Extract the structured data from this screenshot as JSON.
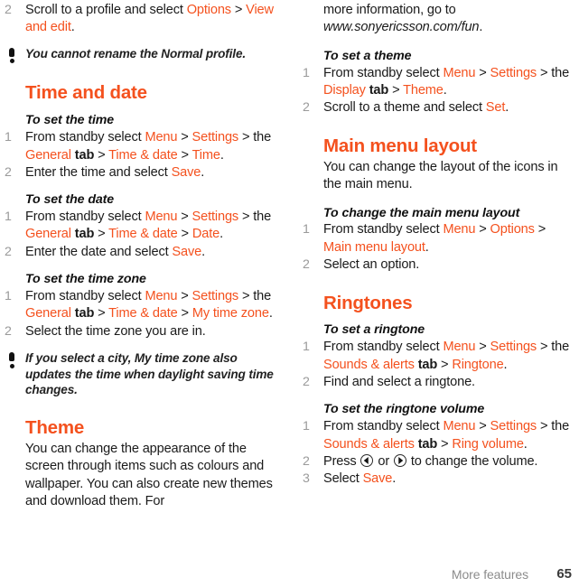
{
  "document": {
    "footer": {
      "chapter_title": "More features",
      "page_number": "65"
    }
  },
  "left_column": {
    "carryover_step": {
      "number": "2",
      "text_before": "Scroll to a profile and select ",
      "ui_1": "Options",
      "sep_1": " > ",
      "ui_2": "View and edit",
      "text_after": "."
    },
    "note_profile": {
      "icon": "exclamation-note-icon",
      "part_1": "You cannot rename the ",
      "part_2_italic_regular": "Normal",
      "part_3": " profile."
    },
    "section_time_and_date": {
      "heading": "Time and date",
      "procedures": [
        {
          "title": "To set the time",
          "steps": [
            {
              "number": "1",
              "segments": [
                {
                  "t": "From standby select ",
                  "style": "plain"
                },
                {
                  "t": "Menu",
                  "style": "ui"
                },
                {
                  "t": " > ",
                  "style": "plain"
                },
                {
                  "t": "Settings",
                  "style": "ui"
                },
                {
                  "t": " > the ",
                  "style": "plain"
                },
                {
                  "t": "General",
                  "style": "ui"
                },
                {
                  "t": " tab > ",
                  "style": "bold-tab"
                },
                {
                  "t": "Time & date",
                  "style": "ui"
                },
                {
                  "t": " > ",
                  "style": "plain"
                },
                {
                  "t": "Time",
                  "style": "ui"
                },
                {
                  "t": ".",
                  "style": "plain"
                }
              ]
            },
            {
              "number": "2",
              "segments": [
                {
                  "t": "Enter the time and select ",
                  "style": "plain"
                },
                {
                  "t": "Save",
                  "style": "ui"
                },
                {
                  "t": ".",
                  "style": "plain"
                }
              ]
            }
          ]
        },
        {
          "title": "To set the date",
          "steps": [
            {
              "number": "1",
              "segments": [
                {
                  "t": "From standby select ",
                  "style": "plain"
                },
                {
                  "t": "Menu",
                  "style": "ui"
                },
                {
                  "t": " > ",
                  "style": "plain"
                },
                {
                  "t": "Settings",
                  "style": "ui"
                },
                {
                  "t": " > the ",
                  "style": "plain"
                },
                {
                  "t": "General",
                  "style": "ui"
                },
                {
                  "t": " tab > ",
                  "style": "bold-tab"
                },
                {
                  "t": "Time & date",
                  "style": "ui"
                },
                {
                  "t": " > ",
                  "style": "plain"
                },
                {
                  "t": "Date",
                  "style": "ui"
                },
                {
                  "t": ".",
                  "style": "plain"
                }
              ]
            },
            {
              "number": "2",
              "segments": [
                {
                  "t": "Enter the date and select ",
                  "style": "plain"
                },
                {
                  "t": "Save",
                  "style": "ui"
                },
                {
                  "t": ".",
                  "style": "plain"
                }
              ]
            }
          ]
        },
        {
          "title": "To set the time zone",
          "steps": [
            {
              "number": "1",
              "segments": [
                {
                  "t": "From standby select ",
                  "style": "plain"
                },
                {
                  "t": "Menu",
                  "style": "ui"
                },
                {
                  "t": " > ",
                  "style": "plain"
                },
                {
                  "t": "Settings",
                  "style": "ui"
                },
                {
                  "t": " > the ",
                  "style": "plain"
                },
                {
                  "t": "General",
                  "style": "ui"
                },
                {
                  "t": " tab > ",
                  "style": "bold-tab"
                },
                {
                  "t": "Time & date",
                  "style": "ui"
                },
                {
                  "t": " > ",
                  "style": "plain"
                },
                {
                  "t": "My time zone",
                  "style": "ui"
                },
                {
                  "t": ".",
                  "style": "plain"
                }
              ]
            },
            {
              "number": "2",
              "segments": [
                {
                  "t": "Select the time zone you are in.",
                  "style": "plain"
                }
              ]
            }
          ]
        }
      ]
    },
    "note_timezone": {
      "icon": "exclamation-note-icon",
      "part_1": "If you select a city, ",
      "part_2_italic_regular": "My time zone",
      "part_3": " also updates the time when daylight saving time changes."
    },
    "section_theme": {
      "heading": "Theme",
      "body_start": "You can change the appearance of the screen through items such as colours and wallpaper. You can also create new themes and download them. For"
    }
  },
  "right_column": {
    "theme_continued": {
      "text_before": "more information, go to ",
      "url": "www.sonyericsson.com/fun",
      "text_after": "."
    },
    "procedure_set_theme": {
      "title": "To set a theme",
      "steps": [
        {
          "number": "1",
          "segments": [
            {
              "t": "From standby select ",
              "style": "plain"
            },
            {
              "t": "Menu",
              "style": "ui"
            },
            {
              "t": " > ",
              "style": "plain"
            },
            {
              "t": "Settings",
              "style": "ui"
            },
            {
              "t": " > the ",
              "style": "plain"
            },
            {
              "t": "Display",
              "style": "ui"
            },
            {
              "t": " tab > ",
              "style": "bold-tab"
            },
            {
              "t": "Theme",
              "style": "ui"
            },
            {
              "t": ".",
              "style": "plain"
            }
          ]
        },
        {
          "number": "2",
          "segments": [
            {
              "t": "Scroll to a theme and select ",
              "style": "plain"
            },
            {
              "t": "Set",
              "style": "ui"
            },
            {
              "t": ".",
              "style": "plain"
            }
          ]
        }
      ]
    },
    "section_main_menu_layout": {
      "heading": "Main menu layout",
      "body": "You can change the layout of the icons in the main menu.",
      "procedures": [
        {
          "title": "To change the main menu layout",
          "steps": [
            {
              "number": "1",
              "segments": [
                {
                  "t": "From standby select ",
                  "style": "plain"
                },
                {
                  "t": "Menu",
                  "style": "ui"
                },
                {
                  "t": " > ",
                  "style": "plain"
                },
                {
                  "t": "Options",
                  "style": "ui"
                },
                {
                  "t": " > ",
                  "style": "plain"
                },
                {
                  "t": "Main menu layout",
                  "style": "ui"
                },
                {
                  "t": ".",
                  "style": "plain"
                }
              ]
            },
            {
              "number": "2",
              "segments": [
                {
                  "t": "Select an option.",
                  "style": "plain"
                }
              ]
            }
          ]
        }
      ]
    },
    "section_ringtones": {
      "heading": "Ringtones",
      "procedures": [
        {
          "title": "To set a ringtone",
          "steps": [
            {
              "number": "1",
              "segments": [
                {
                  "t": "From standby select ",
                  "style": "plain"
                },
                {
                  "t": "Menu",
                  "style": "ui"
                },
                {
                  "t": " > ",
                  "style": "plain"
                },
                {
                  "t": "Settings",
                  "style": "ui"
                },
                {
                  "t": " > the ",
                  "style": "plain"
                },
                {
                  "t": "Sounds & alerts",
                  "style": "ui"
                },
                {
                  "t": " tab > ",
                  "style": "bold-tab"
                },
                {
                  "t": "Ringtone",
                  "style": "ui"
                },
                {
                  "t": ".",
                  "style": "plain"
                }
              ]
            },
            {
              "number": "2",
              "segments": [
                {
                  "t": "Find and select a ringtone.",
                  "style": "plain"
                }
              ]
            }
          ]
        },
        {
          "title": "To set the ringtone volume",
          "steps": [
            {
              "number": "1",
              "segments": [
                {
                  "t": "From standby select ",
                  "style": "plain"
                },
                {
                  "t": "Menu",
                  "style": "ui"
                },
                {
                  "t": " > ",
                  "style": "plain"
                },
                {
                  "t": "Settings",
                  "style": "ui"
                },
                {
                  "t": " > the ",
                  "style": "plain"
                },
                {
                  "t": "Sounds & alerts",
                  "style": "ui"
                },
                {
                  "t": " tab > ",
                  "style": "bold-tab"
                },
                {
                  "t": "Ring volume",
                  "style": "ui"
                },
                {
                  "t": ".",
                  "style": "plain"
                }
              ]
            },
            {
              "number": "2",
              "press_prefix": "Press ",
              "key_left_icon": "nav-key-left-icon",
              "press_middle": " or ",
              "key_right_icon": "nav-key-right-icon",
              "press_suffix": " to change the volume."
            },
            {
              "number": "3",
              "segments": [
                {
                  "t": "Select ",
                  "style": "plain"
                },
                {
                  "t": "Save",
                  "style": "ui"
                },
                {
                  "t": ".",
                  "style": "plain"
                }
              ]
            }
          ]
        }
      ]
    }
  },
  "colors": {
    "accent_orange": "#F4511E",
    "step_number_grey": "#9a9a9a",
    "footer_grey": "#8c8c8c",
    "body_black": "#1a1a1a"
  }
}
